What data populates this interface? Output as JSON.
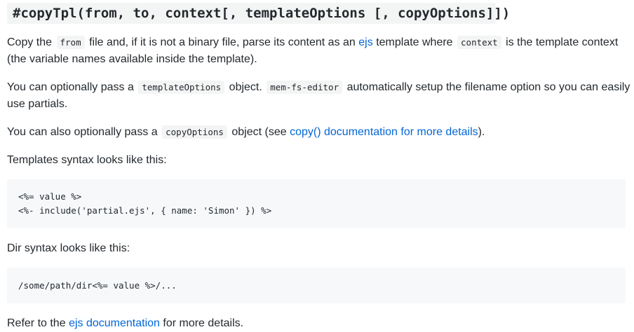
{
  "heading": "#copyTpl(from, to, context[, templateOptions [, copyOptions]])",
  "para1": {
    "t1": "Copy the",
    "code1": "from",
    "t2": "file and, if it is not a binary file, parse its content as an",
    "link": "ejs",
    "t3": "template where",
    "code2": "context",
    "t4": "is the template context (the variable names available inside the template)."
  },
  "para2": {
    "t1": "You can optionally pass a",
    "code1": "templateOptions",
    "t2": "object.",
    "code2": "mem-fs-editor",
    "t3": "automatically setup the filename option so you can easily use partials."
  },
  "para3": {
    "t1": "You can also optionally pass a",
    "code1": "copyOptions",
    "t2": "object (see",
    "link": "copy() documentation for more details",
    "t3": ")."
  },
  "para4": "Templates syntax looks like this:",
  "codeblock1": [
    "<%= value %>",
    "<%- include('partial.ejs', { name: 'Simon' }) %>"
  ],
  "para5": "Dir syntax looks like this:",
  "codeblock2": [
    "/some/path/dir<%= value %>/..."
  ],
  "para6": {
    "t1": "Refer to the",
    "link": "ejs documentation",
    "t2": "for more details."
  },
  "colors": {
    "link": "#0366d6",
    "text": "#24292e",
    "code_bg": "#f6f8fa"
  }
}
